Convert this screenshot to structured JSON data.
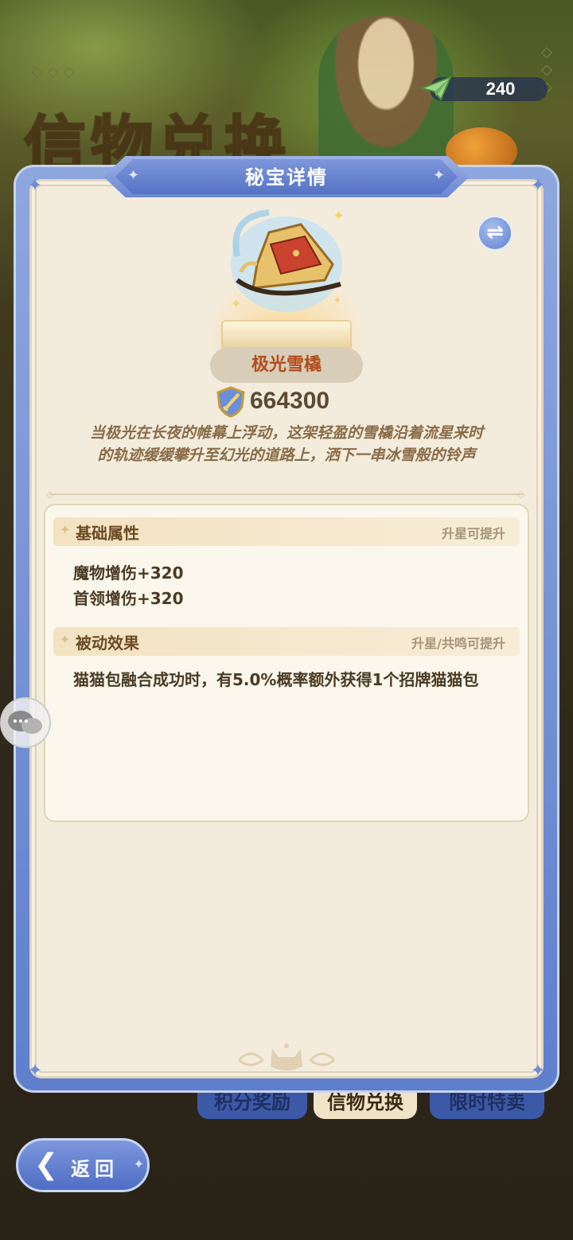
{
  "background": {
    "title": "信物兑换",
    "tabs": [
      "积分奖励",
      "信物兑换",
      "限时特卖"
    ]
  },
  "currency": {
    "icon": "paper-plane-icon",
    "value": "240"
  },
  "dialog": {
    "title": "秘宝详情",
    "swap_icon": "⇌",
    "item": {
      "name": "极光雪橇",
      "power_icon": "shield-sword-icon",
      "power": "664300",
      "flavor_line1": "当极光在长夜的帷幕上浮动，这架轻盈的雪橇沿着流星来时",
      "flavor_line2": "的轨迹缓缓攀升至幻光的道路上，洒下一串冰雪般的铃声"
    },
    "basic": {
      "title": "基础属性",
      "hint": "升星可提升",
      "lines": [
        "魔物增伤+320",
        "首领增伤+320"
      ]
    },
    "passive": {
      "title": "被动效果",
      "hint": "升星/共鸣可提升",
      "text": "猫猫包融合成功时，有5.0%概率额外获得1个招牌猫猫包"
    }
  },
  "back_button": {
    "arrow": "❮",
    "label": "返回"
  },
  "colors": {
    "accent": "#5f7fcd",
    "panel": "#f3ecdd",
    "name": "#b34c1c",
    "text": "#4a3a24"
  }
}
